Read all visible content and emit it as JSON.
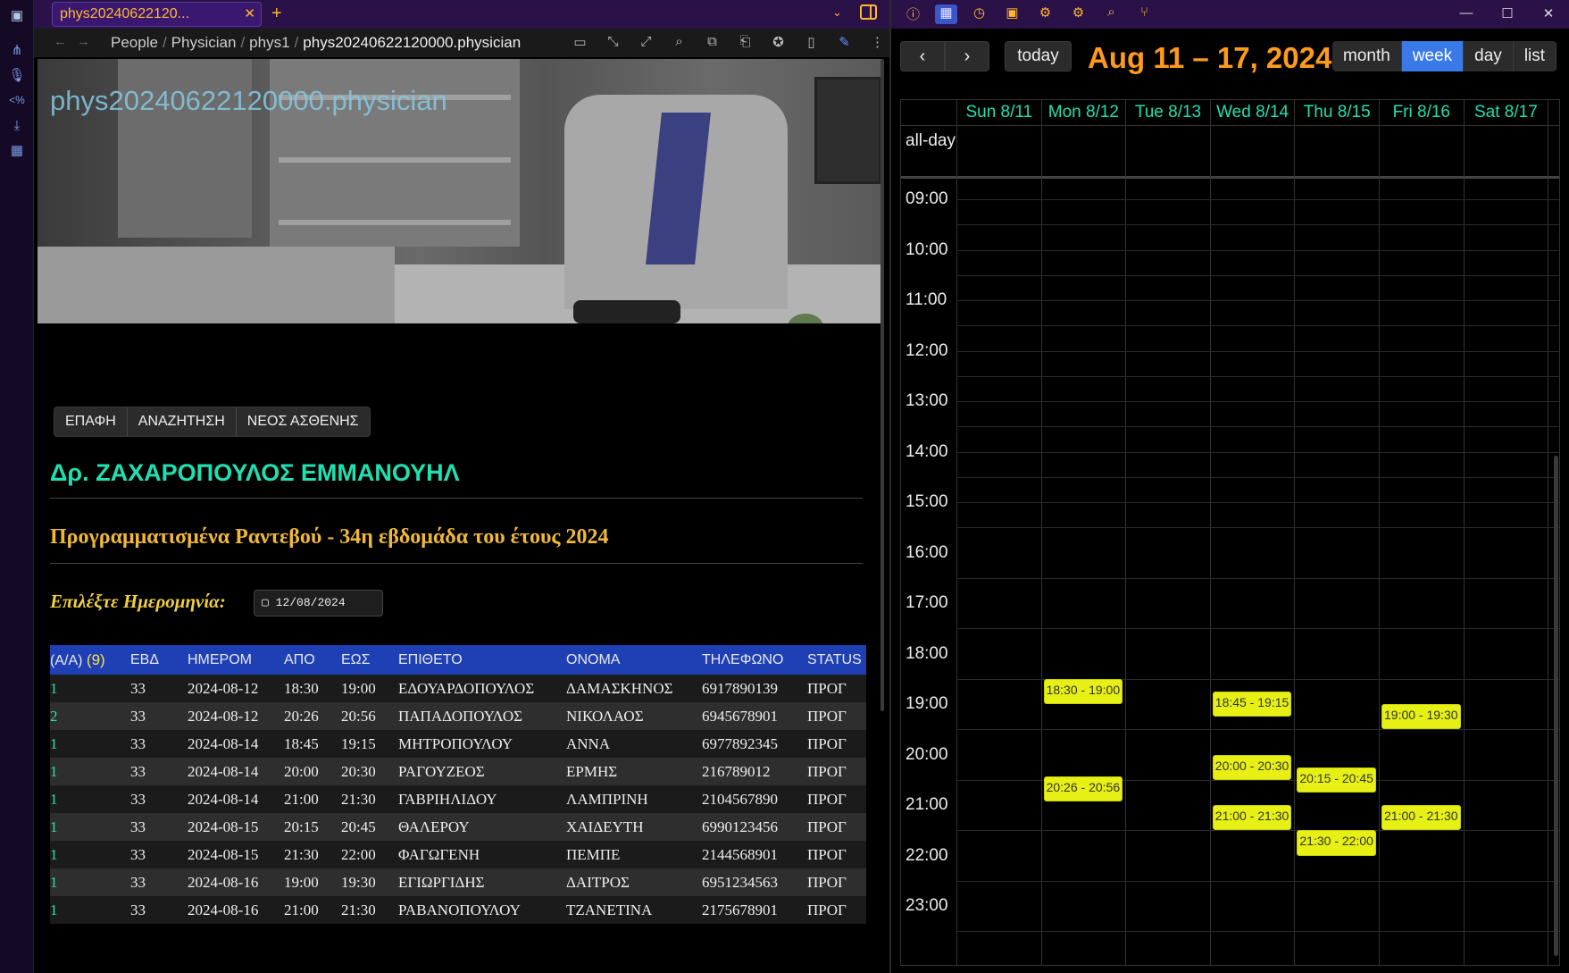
{
  "tab": {
    "title": "phys20240622120...",
    "close": "✕",
    "add": "+"
  },
  "nav": {
    "crumbs": [
      "People",
      "Physician",
      "phys1",
      "phys20240622120000.physician"
    ]
  },
  "banner": {
    "title": "phys20240622120000.physician"
  },
  "buttons": [
    "ΕΠΑΦΗ",
    "ΑΝΑΖΗΤΗΣΗ",
    "ΝΕΟΣ ΑΣΘΕΝΗΣ"
  ],
  "doctor": "Δρ. ΖΑΧΑΡΟΠΟΥΛΟΣ ΕΜΜΑΝΟΥΗΛ",
  "subtitle": "Προγραμματισμένα Ραντεβού - 34η εβδομάδα του έτους 2024",
  "date_label": "Επιλέξτε Ημερομηνία:",
  "date_value": "12/08/2024",
  "table": {
    "headers": [
      "(Α/Α)",
      "ΕΒΔ",
      "ΗΜΕΡΟΜ",
      "ΑΠΟ",
      "ΕΩΣ",
      "ΕΠΙΘΕΤΟ",
      "ΟΝΟΜΑ",
      "ΤΗΛΕΦΩΝΟ",
      "STATUS"
    ],
    "count": "(9)",
    "rows": [
      [
        "1",
        "33",
        "2024-08-12",
        "18:30",
        "19:00",
        "ΕΔΟΥΑΡΔΟΠΟΥΛΟΣ",
        "ΔΑΜΑΣΚΗΝΟΣ",
        "6917890139",
        "ΠΡΟΓ"
      ],
      [
        "2",
        "33",
        "2024-08-12",
        "20:26",
        "20:56",
        "ΠΑΠΑΔΟΠΟΥΛΟΣ",
        "ΝΙΚΟΛΑΟΣ",
        "6945678901",
        "ΠΡΟΓ"
      ],
      [
        "1",
        "33",
        "2024-08-14",
        "18:45",
        "19:15",
        "ΜΗΤΡΟΠΟΥΛΟΥ",
        "ΑΝΝΑ",
        "6977892345",
        "ΠΡΟΓ"
      ],
      [
        "1",
        "33",
        "2024-08-14",
        "20:00",
        "20:30",
        "ΡΑΓΟΥΖΕΟΣ",
        "ΕΡΜΗΣ",
        "216789012",
        "ΠΡΟΓ"
      ],
      [
        "1",
        "33",
        "2024-08-14",
        "21:00",
        "21:30",
        "ΓΑΒΡΙΗΛΙΔΟΥ",
        "ΛΑΜΠΡΙΝΗ",
        "2104567890",
        "ΠΡΟΓ"
      ],
      [
        "1",
        "33",
        "2024-08-15",
        "20:15",
        "20:45",
        "ΘΑΛΕΡΟΥ",
        "ΧΑΙΔΕΥΤΗ",
        "6990123456",
        "ΠΡΟΓ"
      ],
      [
        "1",
        "33",
        "2024-08-15",
        "21:30",
        "22:00",
        "ΦΑΓΩΓΕΝΗ",
        "ΠΕΜΠΕ",
        "2144568901",
        "ΠΡΟΓ"
      ],
      [
        "1",
        "33",
        "2024-08-16",
        "19:00",
        "19:30",
        "ΕΓΙΩΡΓΙΔΗΣ",
        "ΔΑΙΤΡΟΣ",
        "6951234563",
        "ΠΡΟΓ"
      ],
      [
        "1",
        "33",
        "2024-08-16",
        "21:00",
        "21:30",
        "ΡΑΒΑΝΟΠΟΥΛΟΥ",
        "ΤΖΑΝΕΤΙΝΑ",
        "2175678901",
        "ΠΡΟΓ"
      ]
    ]
  },
  "calendar": {
    "title": "Aug 11 – 17, 2024",
    "today_label": "today",
    "prev": "‹",
    "next": "›",
    "views": [
      "month",
      "week",
      "day",
      "list"
    ],
    "active_view": "week",
    "days": [
      "Sun 8/11",
      "Mon 8/12",
      "Tue 8/13",
      "Wed 8/14",
      "Thu 8/15",
      "Fri 8/16",
      "Sat 8/17"
    ],
    "allday_label": "all-day",
    "hours": [
      "09:00",
      "10:00",
      "11:00",
      "12:00",
      "13:00",
      "14:00",
      "15:00",
      "16:00",
      "17:00",
      "18:00",
      "19:00",
      "20:00",
      "21:00",
      "22:00",
      "23:00"
    ],
    "events": [
      {
        "day": 1,
        "start": "18:30",
        "end": "19:00",
        "label": "18:30 - 19:00"
      },
      {
        "day": 1,
        "start": "20:26",
        "end": "20:56",
        "label": "20:26 - 20:56"
      },
      {
        "day": 3,
        "start": "18:45",
        "end": "19:15",
        "label": "18:45 - 19:15"
      },
      {
        "day": 3,
        "start": "20:00",
        "end": "20:30",
        "label": "20:00 - 20:30"
      },
      {
        "day": 3,
        "start": "21:00",
        "end": "21:30",
        "label": "21:00 - 21:30"
      },
      {
        "day": 4,
        "start": "20:15",
        "end": "20:45",
        "label": "20:15 - 20:45"
      },
      {
        "day": 4,
        "start": "21:30",
        "end": "22:00",
        "label": "21:30 - 22:00"
      },
      {
        "day": 5,
        "start": "19:00",
        "end": "19:30",
        "label": "19:00 - 19:30"
      },
      {
        "day": 5,
        "start": "21:00",
        "end": "21:30",
        "label": "21:00 - 21:30"
      }
    ]
  },
  "colors": {
    "accent": "#1fe0b0",
    "event": "#e6f015",
    "title": "#ff9a1a",
    "table_header": "#1e40b4"
  },
  "icons": {
    "ribbon": [
      "sidebar-toggle-icon",
      "graph-icon",
      "microphone-icon",
      "template-icon",
      "download-icon",
      "calendar-icon"
    ],
    "right_top": [
      "info-icon",
      "calendar-icon",
      "clock-icon",
      "calendar-check-icon",
      "plugin-icon",
      "plugin-alt-icon",
      "search-icon",
      "git-branch-icon"
    ]
  }
}
